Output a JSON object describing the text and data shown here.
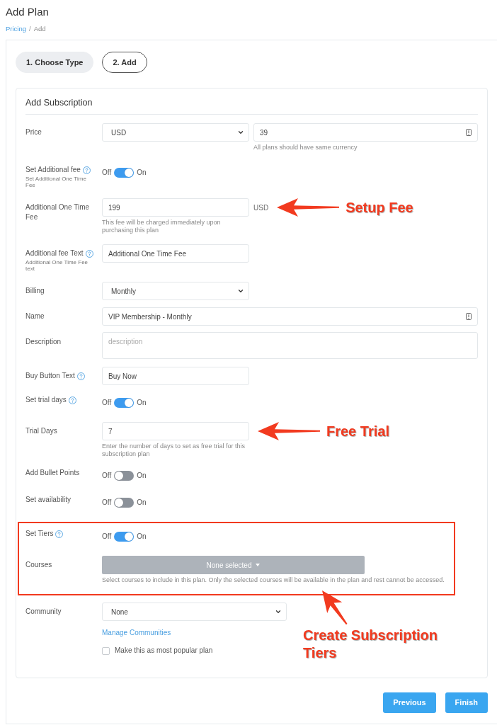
{
  "page": {
    "title": "Add Plan"
  },
  "breadcrumb": [
    {
      "kind": "link",
      "label": "Pricing"
    },
    {
      "kind": "separator",
      "label": "/"
    },
    {
      "kind": "current",
      "label": "Add"
    }
  ],
  "steps": [
    {
      "label": "1. Choose Type",
      "selected": false
    },
    {
      "label": "2. Add",
      "selected": true
    }
  ],
  "form": {
    "title": "Add Subscription",
    "rows": [
      {
        "kind": "price",
        "label": "Price",
        "currency": "USD",
        "amount": "39",
        "help": "All plans should have same currency"
      },
      {
        "kind": "toggle",
        "label": "Set Additional fee",
        "info": true,
        "sublabel": "Set Additional One Time Fee",
        "off_label": "Off",
        "on_label": "On",
        "on": true
      },
      {
        "kind": "input",
        "label": "Additional One Time Fee",
        "value": "199",
        "suffix": "USD",
        "help": "This fee will be charged immediately upon purchasing this plan",
        "annotation": {
          "kind": "arrow_left",
          "text": "Setup Fee"
        }
      },
      {
        "kind": "input",
        "label": "Additional fee Text",
        "info": true,
        "sublabel": "Additional One Time Fee text",
        "value": "Additional One Time Fee"
      },
      {
        "kind": "select",
        "label": "Billing",
        "value": "Monthly"
      },
      {
        "kind": "wide_input",
        "label": "Name",
        "value": "VIP Membership - Monthly"
      },
      {
        "kind": "textarea",
        "label": "Description",
        "placeholder": "description"
      },
      {
        "kind": "input",
        "label": "Buy Button Text",
        "info": true,
        "value": "Buy Now"
      },
      {
        "kind": "toggle",
        "label": "Set trial days",
        "info": true,
        "off_label": "Off",
        "on_label": "On",
        "on": true
      },
      {
        "kind": "input",
        "label": "Trial Days",
        "value": "7",
        "help": "Enter the number of days to set as free trial for this subscription plan",
        "annotation": {
          "kind": "arrow_left",
          "text": "Free Trial"
        }
      },
      {
        "kind": "toggle",
        "label": "Add Bullet Points",
        "off_label": "Off",
        "on_label": "On",
        "on": false
      },
      {
        "kind": "toggle",
        "label": "Set availability",
        "off_label": "Off",
        "on_label": "On",
        "on": false
      },
      {
        "kind": "group",
        "rows": [
          {
            "kind": "toggle",
            "label": "Set Tiers",
            "info": true,
            "off_label": "Off",
            "on_label": "On",
            "on": true
          },
          {
            "kind": "multiselect",
            "label": "Courses",
            "value": "None selected",
            "help": "Select courses to include in this plan. Only the selected courses will be available in the plan and rest cannot be accessed."
          }
        ],
        "annotation": {
          "kind": "arrow_up",
          "text": "Create Subscription Tiers"
        }
      },
      {
        "kind": "community",
        "label": "Community",
        "value": "None",
        "link": "Manage Communities",
        "checkbox": {
          "label": "Make this as most popular plan",
          "checked": false
        }
      }
    ]
  },
  "buttons": [
    {
      "label": "Previous"
    },
    {
      "label": "Finish"
    }
  ]
}
